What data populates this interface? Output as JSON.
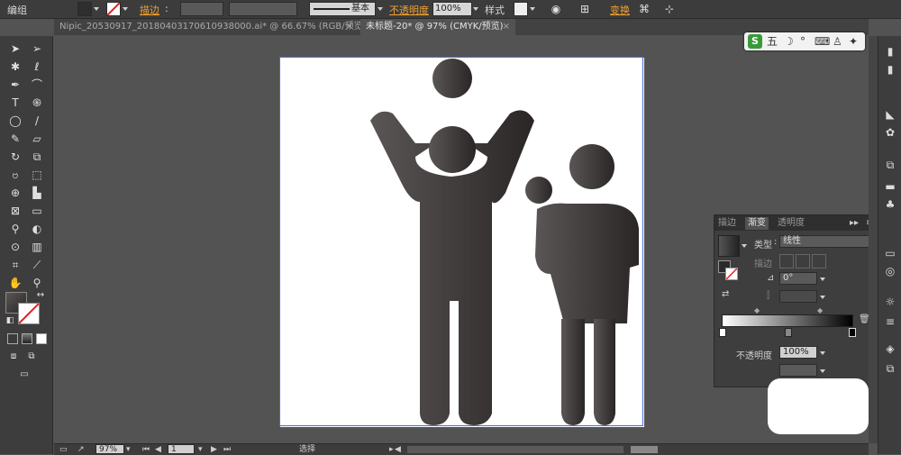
{
  "control_bar": {
    "group_label": "编组",
    "stroke_label": "描边",
    "stroke_colon": ":",
    "stroke_style": "基本",
    "opacity_label": "不透明度",
    "opacity_value": "100%",
    "style_label": "样式",
    "transform_label": "变换"
  },
  "tabs": [
    {
      "label": "Nipic_20530917_20180403170610938000.ai* @ 66.67% (RGB/预览)",
      "close": "×"
    },
    {
      "label": "未标题-20* @ 97% (CMYK/预览)",
      "close": "×"
    }
  ],
  "gradient_panel": {
    "tabs": [
      "描边",
      "渐变",
      "透明度"
    ],
    "type_label": "类型",
    "type_value": "线性",
    "stroke_label": "描边",
    "angle_value": "0°",
    "opacity_label": "不透明度",
    "opacity_value": "100%"
  },
  "ime": {
    "label": "五"
  },
  "status_bar": {
    "zoom": "97%",
    "page": "1",
    "tool_status": "选择"
  },
  "colors": {
    "fill": "#3a3636",
    "gradient_start": "#5a5656",
    "gradient_end": "#2a2626",
    "selection": "#4a6ee0",
    "accent": "#f0a030"
  }
}
